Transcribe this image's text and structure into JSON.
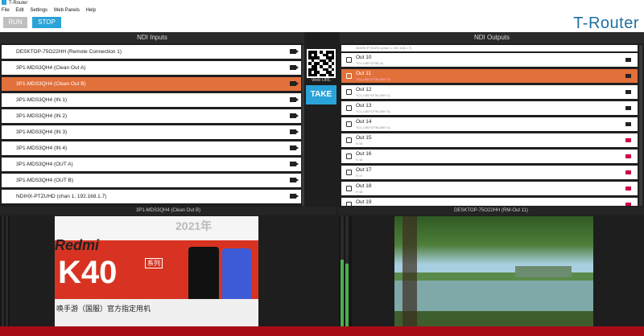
{
  "window": {
    "title": "T-Router"
  },
  "menu": [
    "File",
    "Edit",
    "Settings",
    "Web Panels",
    "Help"
  ],
  "toolbar": {
    "run_label": "RUN",
    "stop_label": "STOP",
    "brand": "T-Router"
  },
  "inputs": {
    "title": "NDI Inputs",
    "items": [
      {
        "label": "DESKTOP-75O22HH (Remote Connection 1)",
        "selected": false
      },
      {
        "label": "3P1-MDS3QH4 (Clean Out A)",
        "selected": false
      },
      {
        "label": "3P1-MDS3QH4 (Clean Out B)",
        "selected": true
      },
      {
        "label": "3P1-MDS3QH4 (IN 1)",
        "selected": false
      },
      {
        "label": "3P1-MDS3QH4 (IN 2)",
        "selected": false
      },
      {
        "label": "3P1-MDS3QH4 (IN 3)",
        "selected": false
      },
      {
        "label": "3P1-MDS3QH4 (IN 4)",
        "selected": false
      },
      {
        "label": "3P1-MDS3QH4 (OUT A)",
        "selected": false
      },
      {
        "label": "3P1-MDS3QH4 (OUT B)",
        "selected": false
      },
      {
        "label": "NDIHX-PTZUHD (chan 1, 192.168.1.7)",
        "selected": false
      }
    ]
  },
  "center": {
    "web_url_label": "Web URL",
    "take_label": "TAKE"
  },
  "outputs": {
    "title": "NDI Outputs",
    "top_partial": "NDIHX-PTZUHD (chan 1, 192.168.1.7)",
    "items": [
      {
        "name": "Out 10",
        "sub": "TC1-C807CF35 (4)",
        "selected": false,
        "active": true
      },
      {
        "name": "Out 11",
        "sub": "TC1-C807CF35 (MIX 1)",
        "selected": true,
        "active": true
      },
      {
        "name": "Out 12",
        "sub": "TC1-C807CF35 (MIX 2)",
        "selected": false,
        "active": true
      },
      {
        "name": "Out 13",
        "sub": "TC1-C807CF35 (MIX 3)",
        "selected": false,
        "active": true
      },
      {
        "name": "Out 14",
        "sub": "TC1-C807CF35 (MIX 4)",
        "selected": false,
        "active": true
      },
      {
        "name": "Out 15",
        "sub": "H 15",
        "selected": false,
        "active": false
      },
      {
        "name": "Out 16",
        "sub": "H 16",
        "selected": false,
        "active": false
      },
      {
        "name": "Out 17",
        "sub": "H 17",
        "selected": false,
        "active": false
      },
      {
        "name": "Out 18",
        "sub": "H 18",
        "selected": false,
        "active": false
      },
      {
        "name": "Out 19",
        "sub": "",
        "selected": false,
        "active": false
      }
    ]
  },
  "previews": {
    "left_title": "3P1-MDS3QH4 (Clean Out B)",
    "right_title": "DESKTOP-75O22HH (RM-Out 11)",
    "left_video_text": {
      "brand": "Redmi",
      "model": "K40",
      "tag": "系列",
      "year": "2021年",
      "caption": "唤手游（国服）官方指定用机"
    },
    "right_meter_levels": [
      0.62,
      0.58
    ]
  },
  "colors": {
    "accent": "#29a3d8",
    "selected": "#e2703a",
    "brand": "#1f6fa0"
  }
}
